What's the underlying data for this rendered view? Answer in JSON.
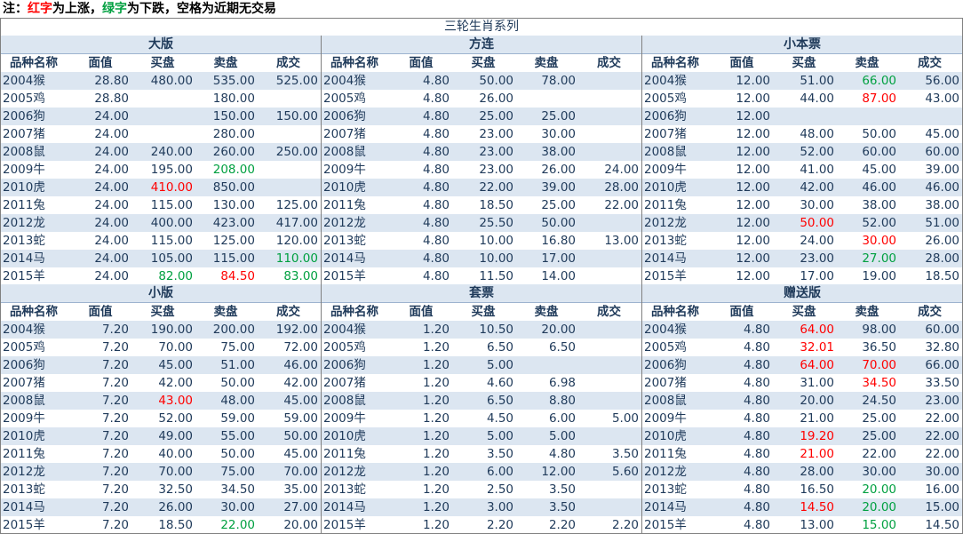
{
  "note": {
    "prefix": "注：",
    "red_word": "红字",
    "mid1": "为上涨，",
    "green_word": "绿字",
    "mid2": "为下跌，空格为近期无交易"
  },
  "title": "三轮生肖系列",
  "colors": {
    "up": "#ff0000",
    "down": "#00a040",
    "band": "#dce6f1",
    "text": "#1f3a5a"
  },
  "columns": [
    "品种名称",
    "面值",
    "买盘",
    "卖盘",
    "成交"
  ],
  "sections": [
    {
      "title": "大版",
      "rows": [
        {
          "name": "2004猴",
          "face": "28.80",
          "buy": "480.00",
          "sell": "535.00",
          "deal": "525.00"
        },
        {
          "name": "2005鸡",
          "face": "28.80",
          "buy": "",
          "sell": "180.00",
          "deal": ""
        },
        {
          "name": "2006狗",
          "face": "24.00",
          "buy": "",
          "sell": "150.00",
          "deal": "150.00"
        },
        {
          "name": "2007猪",
          "face": "24.00",
          "buy": "",
          "sell": "280.00",
          "deal": ""
        },
        {
          "name": "2008鼠",
          "face": "24.00",
          "buy": "240.00",
          "sell": "260.00",
          "deal": "250.00"
        },
        {
          "name": "2009牛",
          "face": "24.00",
          "buy": "195.00",
          "sell": "208.00",
          "deal": "",
          "sell_c": "down"
        },
        {
          "name": "2010虎",
          "face": "24.00",
          "buy": "410.00",
          "sell": "850.00",
          "deal": "",
          "buy_c": "up"
        },
        {
          "name": "2011兔",
          "face": "24.00",
          "buy": "115.00",
          "sell": "130.00",
          "deal": "125.00"
        },
        {
          "name": "2012龙",
          "face": "24.00",
          "buy": "400.00",
          "sell": "423.00",
          "deal": "417.00"
        },
        {
          "name": "2013蛇",
          "face": "24.00",
          "buy": "115.00",
          "sell": "125.00",
          "deal": "120.00"
        },
        {
          "name": "2014马",
          "face": "24.00",
          "buy": "105.00",
          "sell": "115.00",
          "deal": "110.00",
          "deal_c": "down"
        },
        {
          "name": "2015羊",
          "face": "24.00",
          "buy": "82.00",
          "sell": "84.50",
          "deal": "83.00",
          "buy_c": "down",
          "sell_c": "up",
          "deal_c": "down"
        }
      ]
    },
    {
      "title": "方连",
      "rows": [
        {
          "name": "2004猴",
          "face": "4.80",
          "buy": "50.00",
          "sell": "78.00",
          "deal": ""
        },
        {
          "name": "2005鸡",
          "face": "4.80",
          "buy": "26.00",
          "sell": "",
          "deal": ""
        },
        {
          "name": "2006狗",
          "face": "4.80",
          "buy": "25.00",
          "sell": "25.00",
          "deal": ""
        },
        {
          "name": "2007猪",
          "face": "4.80",
          "buy": "23.00",
          "sell": "30.00",
          "deal": ""
        },
        {
          "name": "2008鼠",
          "face": "4.80",
          "buy": "23.00",
          "sell": "38.00",
          "deal": ""
        },
        {
          "name": "2009牛",
          "face": "4.80",
          "buy": "23.00",
          "sell": "26.00",
          "deal": "24.00"
        },
        {
          "name": "2010虎",
          "face": "4.80",
          "buy": "22.00",
          "sell": "39.00",
          "deal": "28.00"
        },
        {
          "name": "2011兔",
          "face": "4.80",
          "buy": "18.50",
          "sell": "25.00",
          "deal": "22.00"
        },
        {
          "name": "2012龙",
          "face": "4.80",
          "buy": "25.50",
          "sell": "50.00",
          "deal": ""
        },
        {
          "name": "2013蛇",
          "face": "4.80",
          "buy": "10.00",
          "sell": "16.80",
          "deal": "13.00"
        },
        {
          "name": "2014马",
          "face": "4.80",
          "buy": "10.00",
          "sell": "17.00",
          "deal": ""
        },
        {
          "name": "2015羊",
          "face": "4.80",
          "buy": "11.50",
          "sell": "14.00",
          "deal": ""
        }
      ]
    },
    {
      "title": "小本票",
      "rows": [
        {
          "name": "2004猴",
          "face": "12.00",
          "buy": "51.00",
          "sell": "66.00",
          "deal": "56.00",
          "sell_c": "down"
        },
        {
          "name": "2005鸡",
          "face": "12.00",
          "buy": "44.00",
          "sell": "87.00",
          "deal": "43.00",
          "sell_c": "up"
        },
        {
          "name": "2006狗",
          "face": "12.00",
          "buy": "",
          "sell": "",
          "deal": ""
        },
        {
          "name": "2007猪",
          "face": "12.00",
          "buy": "48.00",
          "sell": "50.00",
          "deal": "45.00"
        },
        {
          "name": "2008鼠",
          "face": "12.00",
          "buy": "52.00",
          "sell": "60.00",
          "deal": "60.00"
        },
        {
          "name": "2009牛",
          "face": "12.00",
          "buy": "41.00",
          "sell": "45.00",
          "deal": "39.00"
        },
        {
          "name": "2010虎",
          "face": "12.00",
          "buy": "42.00",
          "sell": "46.00",
          "deal": "46.00"
        },
        {
          "name": "2011兔",
          "face": "12.00",
          "buy": "30.00",
          "sell": "38.00",
          "deal": "38.00"
        },
        {
          "name": "2012龙",
          "face": "12.00",
          "buy": "50.00",
          "sell": "52.00",
          "deal": "51.00",
          "buy_c": "up"
        },
        {
          "name": "2013蛇",
          "face": "12.00",
          "buy": "24.00",
          "sell": "30.00",
          "deal": "26.00",
          "sell_c": "up"
        },
        {
          "name": "2014马",
          "face": "12.00",
          "buy": "23.00",
          "sell": "27.00",
          "deal": "28.00",
          "sell_c": "down"
        },
        {
          "name": "2015羊",
          "face": "12.00",
          "buy": "17.00",
          "sell": "19.00",
          "deal": "18.50"
        }
      ]
    },
    {
      "title": "小版",
      "rows": [
        {
          "name": "2004猴",
          "face": "7.20",
          "buy": "190.00",
          "sell": "200.00",
          "deal": "192.00"
        },
        {
          "name": "2005鸡",
          "face": "7.20",
          "buy": "70.00",
          "sell": "75.00",
          "deal": "72.00"
        },
        {
          "name": "2006狗",
          "face": "7.20",
          "buy": "45.00",
          "sell": "51.00",
          "deal": "46.00"
        },
        {
          "name": "2007猪",
          "face": "7.20",
          "buy": "42.00",
          "sell": "50.00",
          "deal": "42.00"
        },
        {
          "name": "2008鼠",
          "face": "7.20",
          "buy": "43.00",
          "sell": "48.00",
          "deal": "45.00",
          "buy_c": "up"
        },
        {
          "name": "2009牛",
          "face": "7.20",
          "buy": "52.00",
          "sell": "59.00",
          "deal": "59.00"
        },
        {
          "name": "2010虎",
          "face": "7.20",
          "buy": "49.00",
          "sell": "55.00",
          "deal": "50.00"
        },
        {
          "name": "2011兔",
          "face": "7.20",
          "buy": "40.00",
          "sell": "50.00",
          "deal": "45.00"
        },
        {
          "name": "2012龙",
          "face": "7.20",
          "buy": "70.00",
          "sell": "75.00",
          "deal": "70.00"
        },
        {
          "name": "2013蛇",
          "face": "7.20",
          "buy": "32.50",
          "sell": "34.50",
          "deal": "35.00"
        },
        {
          "name": "2014马",
          "face": "7.20",
          "buy": "26.00",
          "sell": "30.00",
          "deal": "27.00"
        },
        {
          "name": "2015羊",
          "face": "7.20",
          "buy": "18.50",
          "sell": "22.00",
          "deal": "20.00",
          "sell_c": "down"
        }
      ]
    },
    {
      "title": "套票",
      "rows": [
        {
          "name": "2004猴",
          "face": "1.20",
          "buy": "10.50",
          "sell": "20.00",
          "deal": ""
        },
        {
          "name": "2005鸡",
          "face": "1.20",
          "buy": "6.50",
          "sell": "6.50",
          "deal": ""
        },
        {
          "name": "2006狗",
          "face": "1.20",
          "buy": "5.00",
          "sell": "",
          "deal": ""
        },
        {
          "name": "2007猪",
          "face": "1.20",
          "buy": "4.60",
          "sell": "6.98",
          "deal": ""
        },
        {
          "name": "2008鼠",
          "face": "1.20",
          "buy": "6.50",
          "sell": "8.80",
          "deal": ""
        },
        {
          "name": "2009牛",
          "face": "1.20",
          "buy": "4.50",
          "sell": "6.00",
          "deal": "5.00"
        },
        {
          "name": "2010虎",
          "face": "1.20",
          "buy": "5.00",
          "sell": "5.00",
          "deal": ""
        },
        {
          "name": "2011兔",
          "face": "1.20",
          "buy": "3.50",
          "sell": "4.80",
          "deal": "3.50"
        },
        {
          "name": "2012龙",
          "face": "1.20",
          "buy": "6.00",
          "sell": "12.00",
          "deal": "5.60"
        },
        {
          "name": "2013蛇",
          "face": "1.20",
          "buy": "2.50",
          "sell": "3.50",
          "deal": ""
        },
        {
          "name": "2014马",
          "face": "1.20",
          "buy": "3.00",
          "sell": "3.50",
          "deal": ""
        },
        {
          "name": "2015羊",
          "face": "1.20",
          "buy": "2.20",
          "sell": "2.20",
          "deal": "2.20"
        }
      ]
    },
    {
      "title": "赠送版",
      "rows": [
        {
          "name": "2004猴",
          "face": "4.80",
          "buy": "64.00",
          "sell": "98.00",
          "deal": "60.00",
          "buy_c": "up"
        },
        {
          "name": "2005鸡",
          "face": "4.80",
          "buy": "32.01",
          "sell": "36.50",
          "deal": "32.80",
          "buy_c": "up"
        },
        {
          "name": "2006狗",
          "face": "4.80",
          "buy": "64.00",
          "sell": "70.00",
          "deal": "66.00",
          "buy_c": "up",
          "sell_c": "up"
        },
        {
          "name": "2007猪",
          "face": "4.80",
          "buy": "31.00",
          "sell": "34.50",
          "deal": "33.50",
          "sell_c": "up"
        },
        {
          "name": "2008鼠",
          "face": "4.80",
          "buy": "20.00",
          "sell": "24.50",
          "deal": "23.00"
        },
        {
          "name": "2009牛",
          "face": "4.80",
          "buy": "21.00",
          "sell": "25.00",
          "deal": "22.00"
        },
        {
          "name": "2010虎",
          "face": "4.80",
          "buy": "19.20",
          "sell": "25.00",
          "deal": "22.00",
          "buy_c": "up"
        },
        {
          "name": "2011兔",
          "face": "4.80",
          "buy": "21.00",
          "sell": "22.00",
          "deal": "22.00",
          "buy_c": "up"
        },
        {
          "name": "2012龙",
          "face": "4.80",
          "buy": "28.00",
          "sell": "30.00",
          "deal": "30.00"
        },
        {
          "name": "2013蛇",
          "face": "4.80",
          "buy": "16.50",
          "sell": "20.00",
          "deal": "16.00",
          "sell_c": "down"
        },
        {
          "name": "2014马",
          "face": "4.80",
          "buy": "14.50",
          "sell": "20.00",
          "deal": "15.00",
          "buy_c": "up",
          "sell_c": "down"
        },
        {
          "name": "2015羊",
          "face": "4.80",
          "buy": "13.00",
          "sell": "15.00",
          "deal": "14.50",
          "sell_c": "down"
        }
      ]
    }
  ]
}
